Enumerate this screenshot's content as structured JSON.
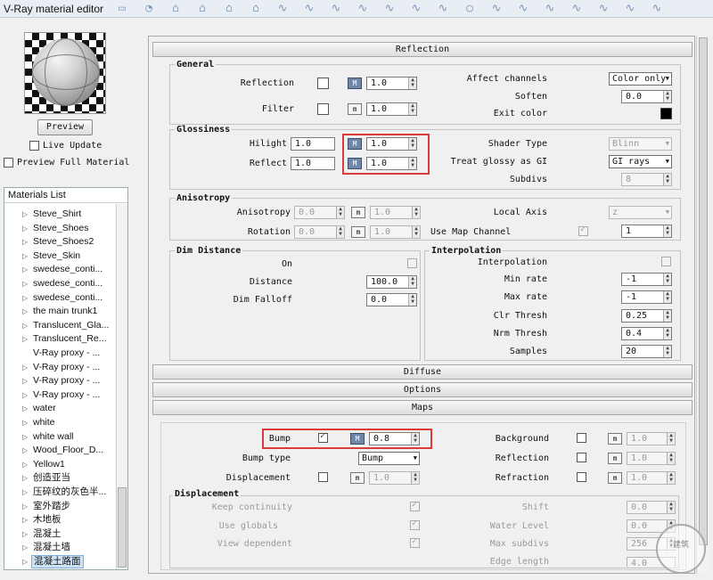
{
  "window": {
    "title": "V-Ray material editor"
  },
  "toolbar": {
    "icons": [
      "comment-icon",
      "bubble-icon",
      "home-icon",
      "home-icon",
      "home-icon",
      "home-icon",
      "curve-icon",
      "curve-icon",
      "curve-icon",
      "curve-icon",
      "curve-icon",
      "curve-icon",
      "curve-icon",
      "circle-icon",
      "curve-icon",
      "curve-icon",
      "curve-icon",
      "curve-icon",
      "curve-icon",
      "curve-icon",
      "curve-icon"
    ]
  },
  "preview": {
    "button": "Preview",
    "live_update": "Live Update",
    "full_material": "Preview Full Material"
  },
  "materials": {
    "header": "Materials List",
    "items": [
      "Steve_Shirt",
      "Steve_Shoes",
      "Steve_Shoes2",
      "Steve_Skin",
      "swedese_conti...",
      "swedese_conti...",
      "swedese_conti...",
      "the main trunk1",
      "Translucent_Gla...",
      "Translucent_Re...",
      "V-Ray proxy - ...",
      "V-Ray proxy - ...",
      "V-Ray proxy - ...",
      "V-Ray proxy - ...",
      "water",
      "white",
      "white wall",
      "Wood_Floor_D...",
      "Yellow1",
      "创造亚当",
      "压碎纹的灰色半...",
      "室外踏步",
      "木地板",
      "混凝土",
      "混凝土墙",
      "混凝土路面"
    ],
    "expandable": [
      true,
      true,
      true,
      true,
      true,
      true,
      true,
      true,
      true,
      true,
      false,
      true,
      true,
      true,
      true,
      true,
      true,
      true,
      true,
      true,
      true,
      true,
      true,
      true,
      true,
      true
    ]
  },
  "reflection": {
    "header": "Reflection",
    "general": {
      "title": "General",
      "reflection_label": "Reflection",
      "reflection_value": "1.0",
      "filter_label": "Filter",
      "filter_value": "1.0",
      "affect_channels_label": "Affect channels",
      "affect_channels_value": "Color only",
      "soften_label": "Soften",
      "soften_value": "0.0",
      "exit_color_label": "Exit color"
    },
    "glossiness": {
      "title": "Glossiness",
      "hilight_label": "Hilight",
      "hilight_value": "1.0",
      "hilight_map_value": "1.0",
      "reflect_label": "Reflect",
      "reflect_value": "1.0",
      "reflect_map_value": "1.0",
      "shader_type_label": "Shader Type",
      "shader_type_value": "Blinn",
      "treat_glossy_label": "Treat glossy as GI",
      "treat_glossy_value": "GI rays only",
      "subdivs_label": "Subdivs",
      "subdivs_value": "8"
    },
    "anisotropy": {
      "title": "Anisotropy",
      "anisotropy_label": "Anisotropy",
      "anisotropy_value": "0.0",
      "anisotropy_map_value": "1.0",
      "rotation_label": "Rotation",
      "rotation_value": "0.0",
      "rotation_map_value": "1.0",
      "local_axis_label": "Local Axis",
      "local_axis_value": "z",
      "use_map_channel_label": "Use Map Channel",
      "use_map_channel_value": "1"
    },
    "dim_distance": {
      "title": "Dim Distance",
      "on_label": "On",
      "distance_label": "Distance",
      "distance_value": "100.0",
      "falloff_label": "Dim Falloff",
      "falloff_value": "0.0"
    },
    "interpolation": {
      "title": "Interpolation",
      "interpolation_label": "Interpolation",
      "min_rate_label": "Min rate",
      "min_rate_value": "-1",
      "max_rate_label": "Max rate",
      "max_rate_value": "-1",
      "clr_thresh_label": "Clr Thresh",
      "clr_thresh_value": "0.25",
      "nrm_thresh_label": "Nrm Thresh",
      "nrm_thresh_value": "0.4",
      "samples_label": "Samples",
      "samples_value": "20"
    }
  },
  "rollouts": {
    "diffuse": "Diffuse",
    "options": "Options",
    "maps": "Maps"
  },
  "maps": {
    "bump_label": "Bump",
    "bump_value": "0.8",
    "bump_type_label": "Bump type",
    "bump_type_value": "Bump",
    "displacement_label": "Displacement",
    "displacement_value": "1.0",
    "background_label": "Background",
    "background_value": "1.0",
    "reflection_label": "Reflection",
    "reflection_value": "1.0",
    "refraction_label": "Refraction",
    "refraction_value": "1.0",
    "disp_group": {
      "title": "Displacement",
      "keep_continuity": "Keep continuity",
      "use_globals": "Use globals",
      "view_dependent": "View dependent",
      "shift_label": "Shift",
      "shift_value": "0.0",
      "water_level_label": "Water Level",
      "water_level_value": "0.0",
      "max_subdivs_label": "Max subdivs",
      "max_subdivs_value": "256",
      "edge_length_label": "Edge length",
      "edge_length_value": "4.0"
    }
  },
  "watermark": {
    "text": "建筑"
  },
  "colors": {
    "accent": "#6e87a8",
    "highlight": "#d83c3c"
  }
}
